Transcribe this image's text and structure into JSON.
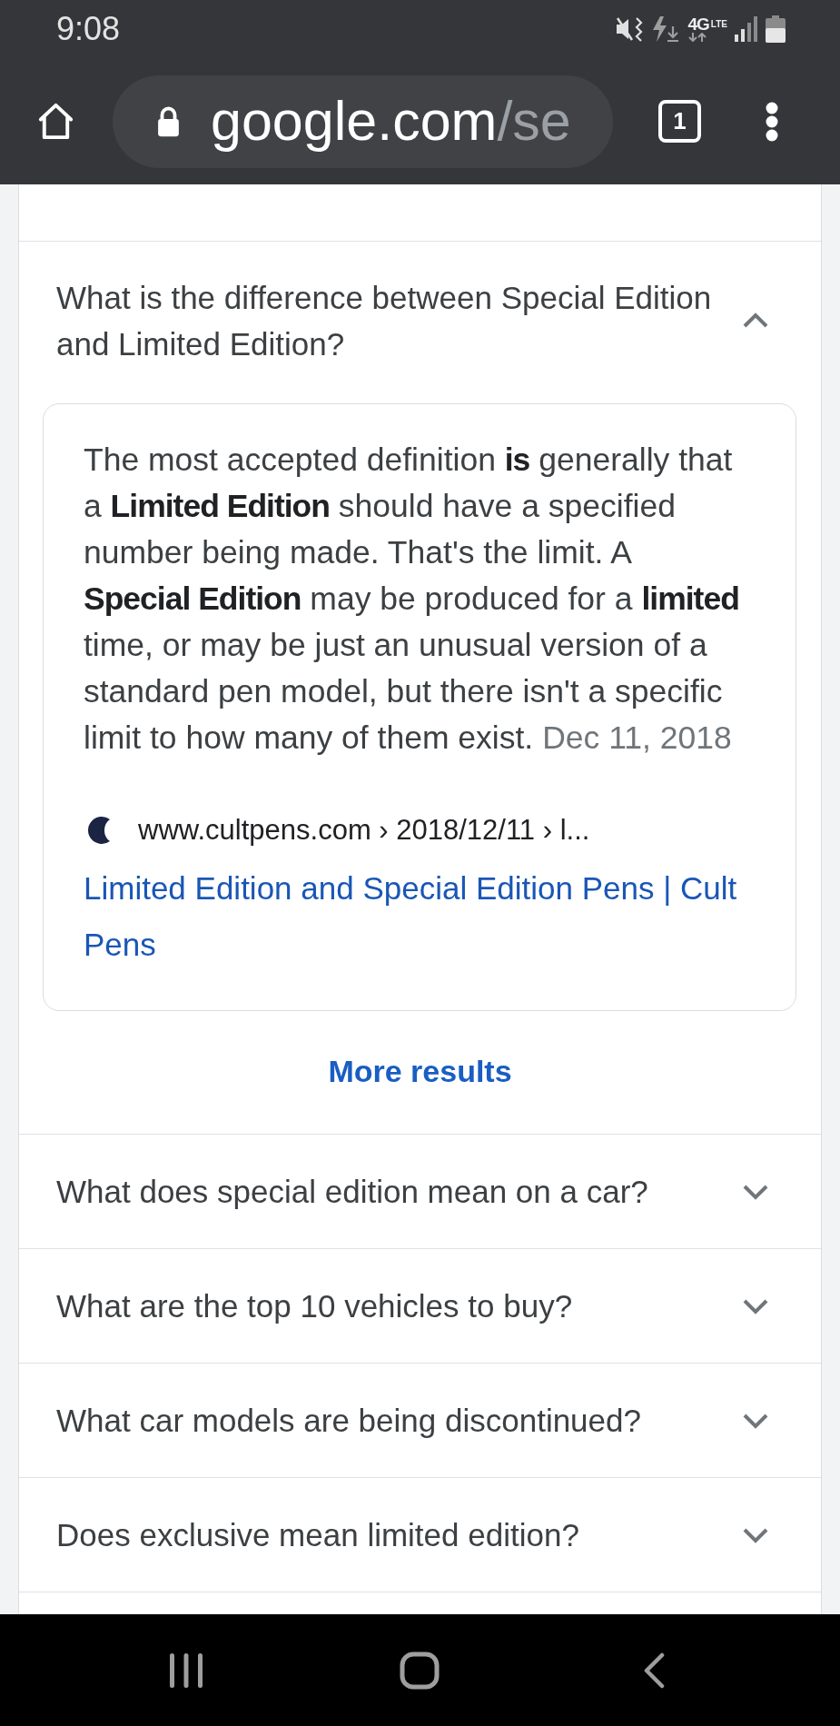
{
  "status_bar": {
    "time": "9:08",
    "network_type": "4G",
    "network_subtype": "LTE"
  },
  "toolbar": {
    "url_host": "google.com",
    "url_path": "/se",
    "tab_count": "1"
  },
  "questions": [
    {
      "text": "What is the difference between Special Edition and Limited Edition?",
      "expanded": true,
      "answer": {
        "text": "The most accepted definition **is** generally that a **Limited Edition** should have a specified number being made. That's the limit. A **Special Edition** may be produced for a **limited** time, or may be just an unusual version of a standard pen model, but there isn't a specific limit to how many of them exist.",
        "date": "Dec 11, 2018",
        "source": "www.cultpens.com › 2018/12/11 › l...",
        "link": "Limited Edition and Special Edition Pens | Cult Pens",
        "more_results": "More results"
      }
    },
    {
      "text": "What does special edition mean on a car?",
      "expanded": false
    },
    {
      "text": "What are the top 10 vehicles to buy?",
      "expanded": false
    },
    {
      "text": "What car models are being discontinued?",
      "expanded": false
    },
    {
      "text": "Does exclusive mean limited edition?",
      "expanded": false
    }
  ]
}
